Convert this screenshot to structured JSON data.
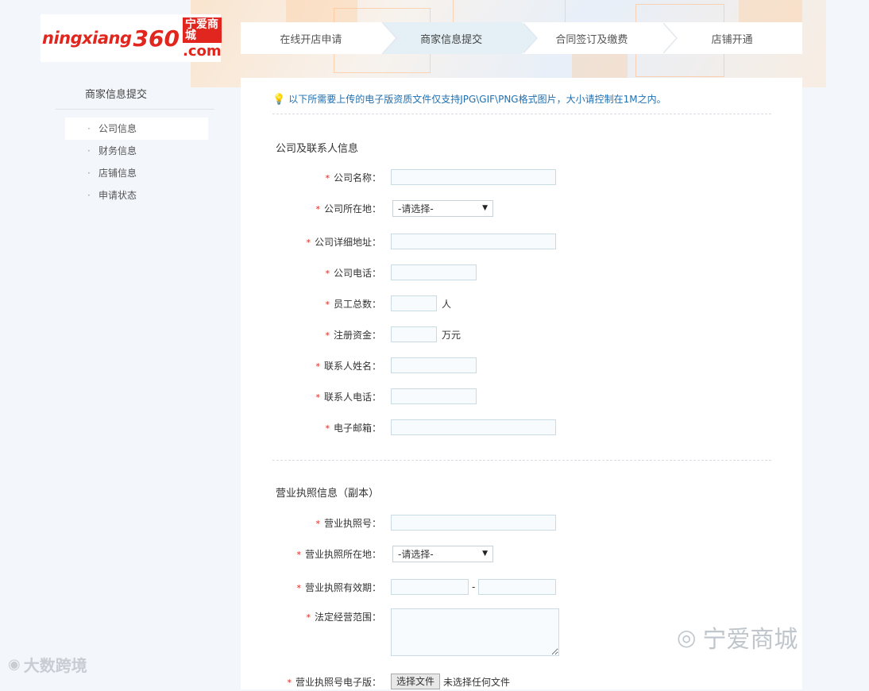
{
  "logo": {
    "word": "ningxiang",
    "num": "360",
    "cn": "宁爱商城",
    "com": ".com"
  },
  "steps": [
    {
      "label": "在线开店申请",
      "active": false
    },
    {
      "label": "商家信息提交",
      "active": true
    },
    {
      "label": "合同签订及缴费",
      "active": false
    },
    {
      "label": "店铺开通",
      "active": false
    }
  ],
  "sidebar": {
    "title": "商家信息提交",
    "items": [
      {
        "label": "公司信息"
      },
      {
        "label": "财务信息"
      },
      {
        "label": "店铺信息"
      },
      {
        "label": "申请状态"
      }
    ]
  },
  "notice": "以下所需要上传的电子版资质文件仅支持JPG\\GIF\\PNG格式图片，大小请控制在1M之内。",
  "sections": {
    "company": "公司及联系人信息",
    "license": "营业执照信息（副本）"
  },
  "fields": {
    "company_name": {
      "label": "公司名称：",
      "value": ""
    },
    "company_location": {
      "label": "公司所在地：",
      "selected": "-请选择-"
    },
    "company_address": {
      "label": "公司详细地址：",
      "value": ""
    },
    "company_phone": {
      "label": "公司电话：",
      "value": ""
    },
    "employees": {
      "label": "员工总数：",
      "value": "",
      "unit": "人"
    },
    "capital": {
      "label": "注册资金：",
      "value": "",
      "unit": "万元"
    },
    "contact_name": {
      "label": "联系人姓名：",
      "value": ""
    },
    "contact_phone": {
      "label": "联系人电话：",
      "value": ""
    },
    "email": {
      "label": "电子邮箱：",
      "value": ""
    },
    "license_no": {
      "label": "营业执照号：",
      "value": ""
    },
    "license_location": {
      "label": "营业执照所在地：",
      "selected": "-请选择-"
    },
    "license_validity": {
      "label": "营业执照有效期：",
      "from": "",
      "to": "",
      "sep": "-"
    },
    "business_scope": {
      "label": "法定经营范围：",
      "value": ""
    },
    "license_file": {
      "label": "营业执照号电子版：",
      "button": "选择文件",
      "note": "未选择任何文件"
    }
  },
  "required_mark": "*",
  "watermarks": {
    "right": "宁爱商城",
    "left": "大数跨境"
  },
  "colors": {
    "accent": "#e0261e",
    "notice": "#1f6fb0",
    "active_step": "#e4f0f5"
  }
}
